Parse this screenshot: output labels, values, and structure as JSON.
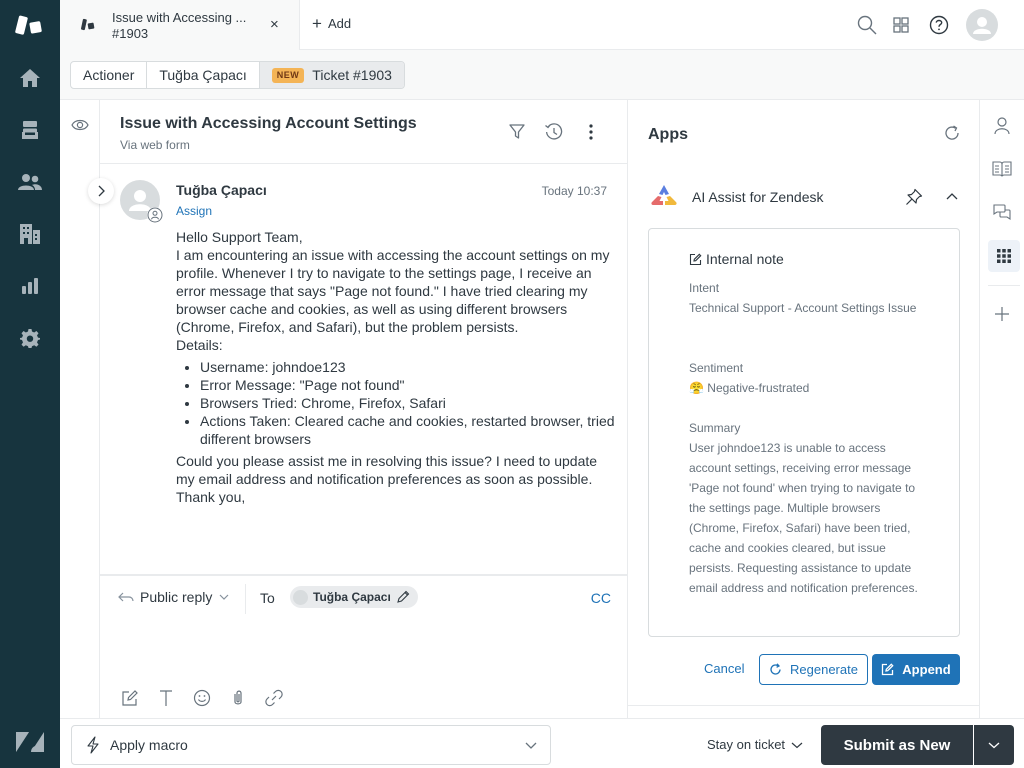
{
  "nav": {
    "items": [
      {
        "name": "home",
        "icon": "home-icon"
      },
      {
        "name": "views",
        "icon": "inbox-icon"
      },
      {
        "name": "customers",
        "icon": "users-icon"
      },
      {
        "name": "organizations",
        "icon": "building-icon"
      },
      {
        "name": "reporting",
        "icon": "bar-chart-icon"
      },
      {
        "name": "admin",
        "icon": "gear-icon"
      }
    ]
  },
  "topbar": {
    "tab": {
      "title": "Issue with Accessing ...",
      "subtitle": "#1903",
      "close": "×"
    },
    "add_label": "Add",
    "icons": [
      "search-icon",
      "apps-grid-icon",
      "help-icon",
      "avatar"
    ]
  },
  "breadcrumb": {
    "items": [
      "Actioner",
      "Tuğba Çapacı",
      "Ticket #1903"
    ],
    "badge": "NEW"
  },
  "conversation": {
    "title": "Issue with Accessing Account Settings",
    "channel": "Via web form",
    "message": {
      "author": "Tuğba Çapacı",
      "assign_label": "Assign",
      "time": "Today 10:37",
      "greeting": "Hello Support Team,",
      "paragraph": "I am encountering an issue with accessing the account settings on my profile. Whenever I try to navigate to the settings page, I receive an error message that says \"Page not found.\" I have tried clearing my browser cache and cookies, as well as using different browsers (Chrome, Firefox, and Safari), but the problem persists.",
      "details_label": "Details:",
      "details": [
        "Username: johndoe123",
        "Error Message: \"Page not found\"",
        "Browsers Tried: Chrome, Firefox, Safari",
        "Actions Taken: Cleared cache and cookies, restarted browser, tried different browsers"
      ],
      "closing": "Could you please assist me in resolving this issue? I need to update my email address and notification preferences as soon as possible.",
      "signoff": "Thank you,"
    },
    "reply": {
      "type_label": "Public reply",
      "to_label": "To",
      "recipient": "Tuğba Çapacı",
      "cc_label": "CC",
      "tools": [
        "compose-icon",
        "text-format-icon",
        "emoji-icon",
        "attachment-icon",
        "link-icon"
      ]
    }
  },
  "apps": {
    "title": "Apps",
    "app_name": "AI Assist for Zendesk",
    "note": {
      "header": "Internal note",
      "intent_label": "Intent",
      "intent_value": "Technical Support - Account Settings Issue",
      "sentiment_label": "Sentiment",
      "sentiment_emoji": "😤",
      "sentiment_value": "Negative-frustrated",
      "summary_label": "Summary",
      "summary_value": "User johndoe123 is unable to access account settings, receiving error message 'Page not found' when trying to navigate to the settings page. Multiple browsers (Chrome, Firefox, Safari) have been tried, cache and cookies cleared, but issue persists. Requesting assistance to update email address and notification preferences."
    },
    "buttons": {
      "cancel": "Cancel",
      "regenerate": "Regenerate",
      "append": "Append"
    }
  },
  "right_strip": {
    "items": [
      "user-icon",
      "knowledge-icon",
      "conversations-icon",
      "apps-icon",
      "add-icon"
    ],
    "active": "apps-icon"
  },
  "footer": {
    "macro_label": "Apply macro",
    "stay_label": "Stay on ticket",
    "submit_label": "Submit as New"
  },
  "colors": {
    "nav_bg": "#17343e",
    "accent": "#1f73b7",
    "submit_bg": "#2f3941",
    "new_badge": "#f4b456"
  }
}
